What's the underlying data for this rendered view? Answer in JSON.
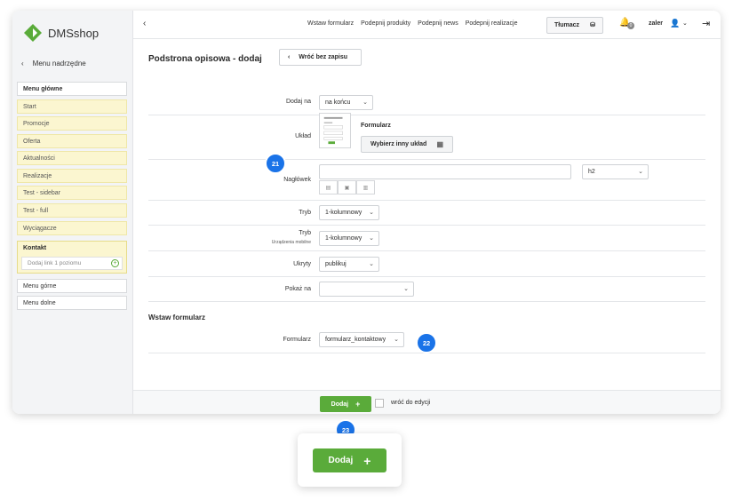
{
  "app": {
    "logo_text": "DMSshop",
    "brand_color": "#5aab3a",
    "accent_blue": "#1a73e8"
  },
  "sidebar": {
    "back_label": "Menu nadrzędne",
    "main_menu_label": "Menu główne",
    "items": [
      "Start",
      "Promocje",
      "Oferta",
      "Aktualności",
      "Realizacje",
      "Test - sidebar",
      "Test - full",
      "Wyciągacze"
    ],
    "kontakt_label": "Kontakt",
    "add_link_placeholder": "Dodaj link 1 poziomu",
    "top_menu_label": "Menu górne",
    "bottom_menu_label": "Menu dolne"
  },
  "topbar": {
    "links": [
      "Wstaw formularz",
      "Podepnij produkty",
      "Podepnij news",
      "Podepnij realizacje"
    ],
    "translate_label": "Tłumacz",
    "notification_count": "0",
    "username": "zaler"
  },
  "main": {
    "title": "Podstrona opisowa - dodaj",
    "back_button": "Wróć bez zapisu",
    "fields": {
      "add_to_label": "Dodaj na",
      "add_to_value": "na końcu",
      "layout_label": "Układ",
      "layout_name": "Formularz",
      "choose_layout_button": "Wybierz inny układ",
      "heading_label": "Nagłówek",
      "heading_value": "",
      "heading_tag": "h2",
      "mode_label": "Tryb",
      "mode_value": "1-kolumnowy",
      "mobile_mode_label": "Tryb",
      "mobile_mode_sublabel": "Urządzenia mobilne",
      "mobile_mode_value": "1-kolumnowy",
      "hidden_label": "Ukryty",
      "hidden_value": "publikuj",
      "show_on_label": "Pokaż na",
      "show_on_value": ""
    },
    "form_section_title": "Wstaw formularz",
    "form_label": "Formularz",
    "form_value": "formularz_kontaktowy"
  },
  "footer": {
    "add_button": "Dodaj",
    "return_checkbox_label": "wróć do edycji"
  },
  "annotations": {
    "b21": "21",
    "b22": "22",
    "b23": "23"
  },
  "zoom": {
    "add_button": "Dodaj"
  }
}
